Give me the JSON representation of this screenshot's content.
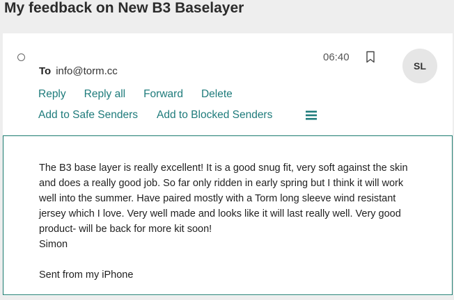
{
  "email": {
    "subject": "My feedback on New B3 Baselayer",
    "to_label": "To",
    "to_address": "info@torm.cc",
    "time": "06:40",
    "avatar_initials": "SL",
    "actions_row1": [
      "Reply",
      "Reply all",
      "Forward",
      "Delete"
    ],
    "actions_row2": [
      "Add to Safe Senders",
      "Add to Blocked Senders"
    ],
    "body_paragraph": "The B3 base layer is really excellent! It is a good snug fit, very soft against the skin and does a really good job. So far only ridden in early spring but I think it will work well into the summer. Have paired mostly with a Torm long sleeve wind resistant jersey which I love. Very well made and looks like it will last really well. Very good product- will be back for more kit soon!",
    "body_name": "Simon",
    "body_signature": "Sent from my iPhone"
  },
  "icons": {
    "read_status": "circle-icon",
    "flag": "bookmark-icon",
    "more": "hamburger-menu-icon"
  },
  "colors": {
    "accent": "#1e7b7b",
    "border": "#1a7a6e",
    "background": "#eeeeee"
  }
}
